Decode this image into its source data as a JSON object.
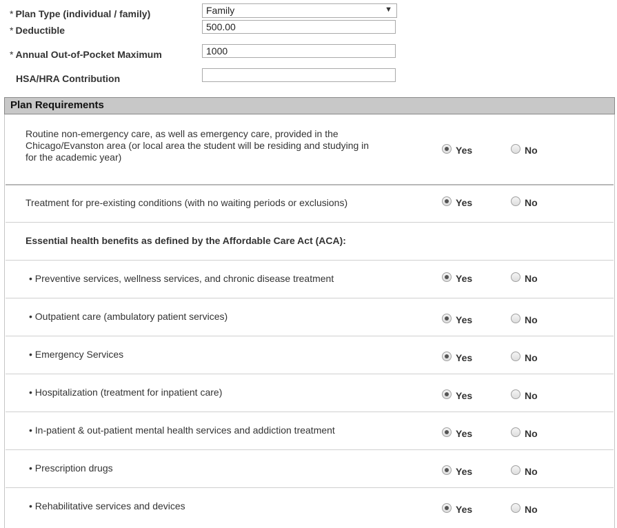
{
  "form": {
    "plan_type": {
      "label": "Plan Type (individual / family)",
      "value": "Family"
    },
    "deductible": {
      "label": "Deductible",
      "value": "500.00"
    },
    "oop_max": {
      "label": "Annual Out-of-Pocket Maximum",
      "value": "1000"
    },
    "hsa": {
      "label": "HSA/HRA Contribution",
      "value": ""
    },
    "required_marker": "*"
  },
  "section": {
    "title": "Plan Requirements",
    "yes_label": "Yes",
    "no_label": "No",
    "rows": [
      {
        "lines": [
          "Routine non-emergency care, as well as emergency care, provided in the",
          "Chicago/Evanston area (or local area the student will be residing and studying in",
          "for the academic year)"
        ],
        "selected": "yes"
      },
      {
        "lines": [
          "Treatment for pre-existing conditions (with no waiting periods or exclusions)"
        ],
        "selected": "yes"
      },
      {
        "heading": "Essential health benefits as defined by the Affordable Care Act (ACA):"
      },
      {
        "lines": [
          "• Preventive services, wellness services, and chronic disease treatment"
        ],
        "selected": "yes"
      },
      {
        "lines": [
          "• Outpatient care (ambulatory patient services)"
        ],
        "selected": "yes"
      },
      {
        "lines": [
          "• Emergency Services"
        ],
        "selected": "yes"
      },
      {
        "lines": [
          "• Hospitalization (treatment for inpatient care)"
        ],
        "selected": "yes"
      },
      {
        "lines": [
          "• In-patient & out-patient mental health services and addiction treatment"
        ],
        "selected": "yes"
      },
      {
        "lines": [
          "• Prescription drugs"
        ],
        "selected": "yes"
      },
      {
        "lines": [
          "• Rehabilitative services and devices"
        ],
        "selected": "yes"
      }
    ]
  }
}
